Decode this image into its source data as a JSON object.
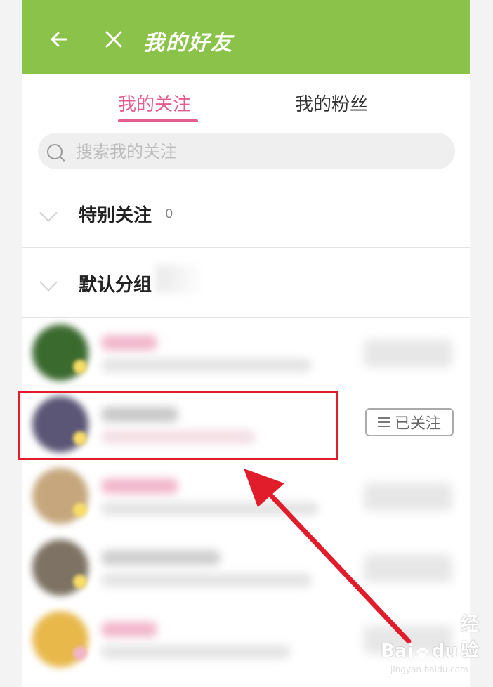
{
  "header": {
    "title": "我的好友",
    "back_icon": "arrow-left-icon",
    "close_icon": "close-icon"
  },
  "tabs": [
    {
      "label": "我的关注",
      "active": true
    },
    {
      "label": "我的粉丝",
      "active": false
    }
  ],
  "search": {
    "placeholder": "搜索我的关注"
  },
  "groups": [
    {
      "name": "特别关注",
      "count": "0"
    },
    {
      "name": "默认分组"
    }
  ],
  "list": {
    "follow_button_label": "已关注",
    "follow_button_icon": "menu-icon"
  },
  "annotations": {
    "highlight_color": "#e11d2b",
    "arrow_color": "#e11d2b"
  },
  "watermark": {
    "brand": "Bai",
    "brand_icon": "paw-icon",
    "brand_end": "du",
    "suffix": "经验",
    "domain": "jingyan.baidu.com"
  },
  "colors": {
    "header": "#8bc34a",
    "accent_pink": "#e45d8f"
  }
}
